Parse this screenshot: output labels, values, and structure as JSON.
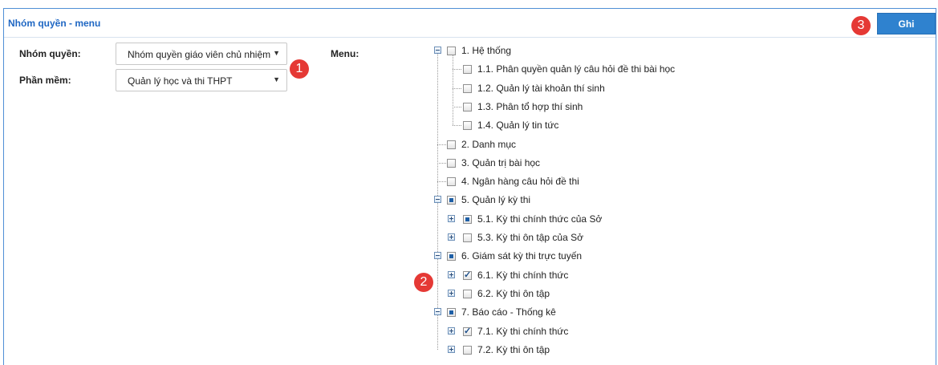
{
  "panel": {
    "title": "Nhóm quyền - menu"
  },
  "toolbar": {
    "save_label": "Ghi"
  },
  "badges": {
    "b1": "1",
    "b2": "2",
    "b3": "3"
  },
  "form": {
    "group_label": "Nhóm quyền:",
    "group_value": "Nhóm quyền giáo viên chủ nhiệm",
    "software_label": "Phần mềm:",
    "software_value": "Quản lý học và thi THPT",
    "menu_label": "Menu:"
  },
  "tree": [
    {
      "label": "1. Hệ thống",
      "state": "unchecked"
    },
    {
      "label": "1.1. Phân quyền quản lý câu hỏi đề thi bài học",
      "state": "unchecked"
    },
    {
      "label": "1.2. Quản lý tài khoản thí sinh",
      "state": "unchecked"
    },
    {
      "label": "1.3. Phân tổ hợp thí sinh",
      "state": "unchecked"
    },
    {
      "label": "1.4. Quản lý tin tức",
      "state": "unchecked"
    },
    {
      "label": "2. Danh mục",
      "state": "unchecked"
    },
    {
      "label": "3. Quản trị bài học",
      "state": "unchecked"
    },
    {
      "label": "4. Ngân hàng câu hỏi đề thi",
      "state": "unchecked"
    },
    {
      "label": "5. Quản lý kỳ thi",
      "state": "partial"
    },
    {
      "label": "5.1. Kỳ thi chính thức của Sở",
      "state": "partial"
    },
    {
      "label": "5.3. Kỳ thi ôn tập của Sở",
      "state": "unchecked"
    },
    {
      "label": "6. Giám sát kỳ thi trực tuyến",
      "state": "partial"
    },
    {
      "label": "6.1. Kỳ thi chính thức",
      "state": "checked"
    },
    {
      "label": "6.2. Kỳ thi ôn tập",
      "state": "unchecked"
    },
    {
      "label": "7. Báo cáo - Thống kê",
      "state": "partial"
    },
    {
      "label": "7.1. Kỳ thi chính thức",
      "state": "checked"
    },
    {
      "label": "7.2. Kỳ thi ôn tập",
      "state": "unchecked"
    }
  ],
  "colors": {
    "accent": "#2f82cf",
    "title": "#1f67c3",
    "badge": "#e53935"
  }
}
